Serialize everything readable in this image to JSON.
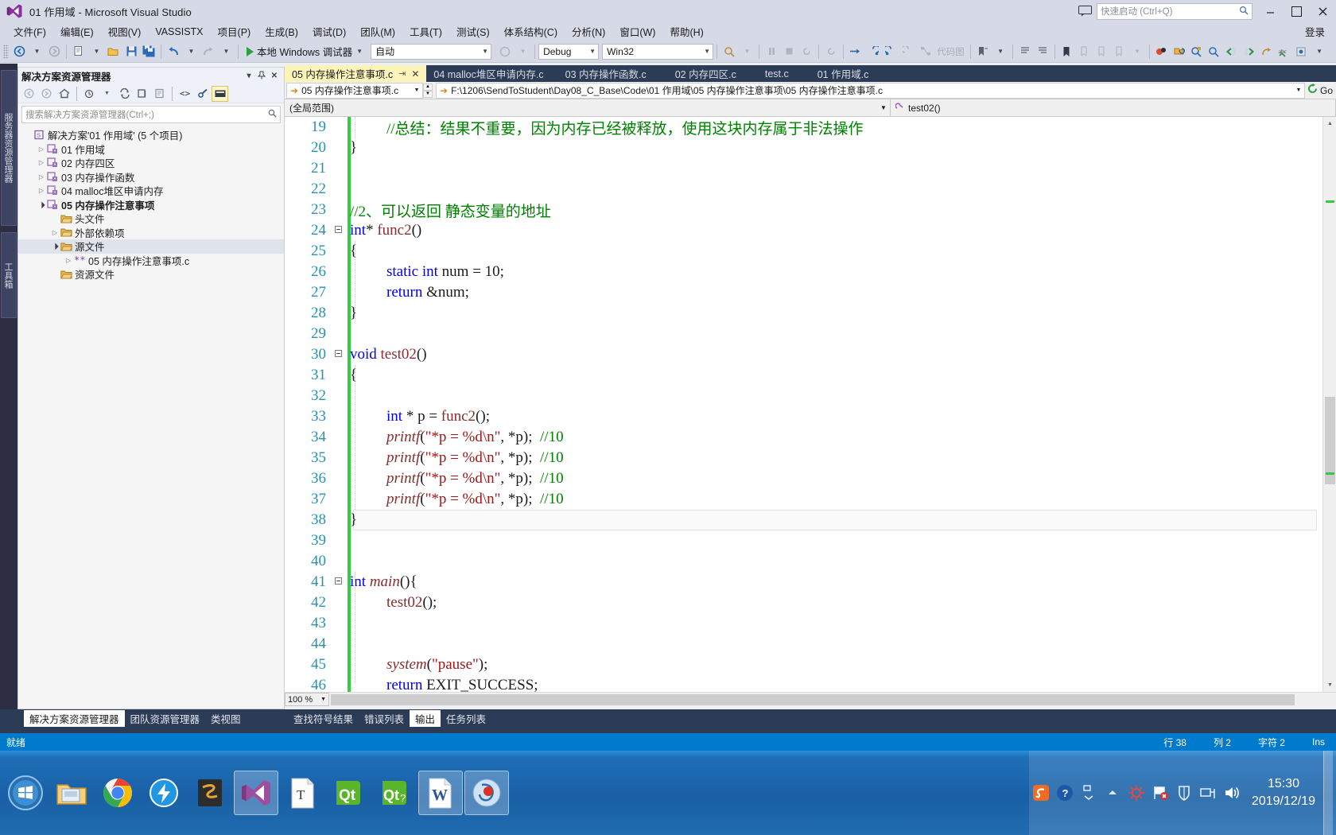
{
  "titlebar": {
    "title": "01 作用域 - Microsoft Visual Studio",
    "quick_launch_placeholder": "快速启动 (Ctrl+Q)",
    "minimize": "—",
    "maximize": "❐",
    "close": "✕",
    "feedback_icon": "feedback-icon",
    "search_icon": "search-icon"
  },
  "menubar": {
    "items": [
      {
        "label": "文件(F)"
      },
      {
        "label": "编辑(E)"
      },
      {
        "label": "视图(V)"
      },
      {
        "label": "VASSISTX"
      },
      {
        "label": "项目(P)"
      },
      {
        "label": "生成(B)"
      },
      {
        "label": "调试(D)"
      },
      {
        "label": "团队(M)"
      },
      {
        "label": "工具(T)"
      },
      {
        "label": "测试(S)"
      },
      {
        "label": "体系结构(C)"
      },
      {
        "label": "分析(N)"
      },
      {
        "label": "窗口(W)"
      },
      {
        "label": "帮助(H)"
      }
    ],
    "signin": "登录"
  },
  "toolbar": {
    "run_label": "本地 Windows 调试器",
    "config": "自动",
    "solution_config": "Debug",
    "platform": "Win32",
    "codemap_label": "代码图"
  },
  "vertical_tabs": [
    {
      "label": "服务器资源管理器"
    },
    {
      "label": "工具箱"
    }
  ],
  "solution_explorer": {
    "title": "解决方案资源管理器",
    "search_placeholder": "搜索解决方案资源管理器(Ctrl+;)",
    "root": "解决方案'01 作用域' (5 个项目)",
    "nodes": [
      {
        "label": "01 作用域",
        "indent": 1,
        "arrow": "collapsed",
        "icon": "project-icon",
        "bold": false
      },
      {
        "label": "02 内存四区",
        "indent": 1,
        "arrow": "collapsed",
        "icon": "project-icon",
        "bold": false
      },
      {
        "label": "03 内存操作函数",
        "indent": 1,
        "arrow": "collapsed",
        "icon": "project-icon",
        "bold": false
      },
      {
        "label": "04 malloc堆区申请内存",
        "indent": 1,
        "arrow": "collapsed",
        "icon": "project-icon",
        "bold": false
      },
      {
        "label": "05 内存操作注意事项",
        "indent": 1,
        "arrow": "expanded",
        "icon": "project-icon",
        "bold": true
      },
      {
        "label": "头文件",
        "indent": 2,
        "arrow": "none",
        "icon": "folder-icon",
        "bold": false
      },
      {
        "label": "外部依赖项",
        "indent": 2,
        "arrow": "collapsed",
        "icon": "folder-icon",
        "bold": false
      },
      {
        "label": "源文件",
        "indent": 2,
        "arrow": "expanded",
        "icon": "folder-icon",
        "bold": false,
        "selected": true
      },
      {
        "label": "05 内存操作注意事项.c",
        "indent": 3,
        "arrow": "collapsed",
        "icon": "c-file-icon",
        "bold": false
      },
      {
        "label": "资源文件",
        "indent": 2,
        "arrow": "none",
        "icon": "folder-icon",
        "bold": false
      }
    ]
  },
  "editor": {
    "tabs": [
      {
        "label": "05 内存操作注意事项.c",
        "active": true,
        "pin": "⇥",
        "close": "✕"
      },
      {
        "label": "04 malloc堆区申请内存.c",
        "active": false
      },
      {
        "label": "03 内存操作函数.c",
        "active": false
      },
      {
        "label": "02 内存四区.c",
        "active": false
      },
      {
        "label": "test.c",
        "active": false
      },
      {
        "label": "01 作用域.c",
        "active": false
      }
    ],
    "nav_file": "05 内存操作注意事项.c",
    "nav_path": "F:\\1206\\SendToStudent\\Day08_C_Base\\Code\\01 作用域\\05 内存操作注意事项\\05 内存操作注意事项.c",
    "go_label": "Go",
    "scope_left": "(全局范围)",
    "scope_right": "test02()",
    "zoom": "100 %",
    "lines": [
      {
        "n": 19,
        "fold": "",
        "indent": 2,
        "tokens": [
          {
            "t": "//总结：结果不重要，因为内存已经被释放，使用这块内存属于非法操作",
            "c": "c-com"
          }
        ]
      },
      {
        "n": 20,
        "fold": "",
        "indent": 0,
        "tokens": [
          {
            "t": "}",
            "c": "c-pln"
          }
        ]
      },
      {
        "n": 21,
        "fold": "",
        "indent": 0,
        "tokens": []
      },
      {
        "n": 22,
        "fold": "",
        "indent": 0,
        "tokens": []
      },
      {
        "n": 23,
        "fold": "",
        "indent": 0,
        "tokens": [
          {
            "t": "//2、可以返回 静态变量的地址",
            "c": "c-com"
          }
        ]
      },
      {
        "n": 24,
        "fold": "minus",
        "indent": 0,
        "tokens": [
          {
            "t": "int",
            "c": "c-kw"
          },
          {
            "t": "* ",
            "c": "c-pln"
          },
          {
            "t": "func2",
            "c": "c-fn2"
          },
          {
            "t": "()",
            "c": "c-pln"
          }
        ]
      },
      {
        "n": 25,
        "fold": "",
        "indent": 0,
        "tokens": [
          {
            "t": "{",
            "c": "c-pln"
          }
        ]
      },
      {
        "n": 26,
        "fold": "",
        "indent": 2,
        "tokens": [
          {
            "t": "static",
            "c": "c-kw"
          },
          {
            "t": " ",
            "c": "c-pln"
          },
          {
            "t": "int",
            "c": "c-kw"
          },
          {
            "t": " num = 10;",
            "c": "c-pln"
          }
        ]
      },
      {
        "n": 27,
        "fold": "",
        "indent": 2,
        "tokens": [
          {
            "t": "return",
            "c": "c-kw"
          },
          {
            "t": " &num;",
            "c": "c-pln"
          }
        ]
      },
      {
        "n": 28,
        "fold": "",
        "indent": 0,
        "tokens": [
          {
            "t": "}",
            "c": "c-pln"
          }
        ]
      },
      {
        "n": 29,
        "fold": "",
        "indent": 0,
        "tokens": []
      },
      {
        "n": 30,
        "fold": "minus",
        "indent": 0,
        "tokens": [
          {
            "t": "void",
            "c": "c-kw"
          },
          {
            "t": " ",
            "c": "c-pln"
          },
          {
            "t": "test02",
            "c": "c-fn2"
          },
          {
            "t": "()",
            "c": "c-pln"
          }
        ]
      },
      {
        "n": 31,
        "fold": "",
        "indent": 0,
        "tokens": [
          {
            "t": "{",
            "c": "c-pln"
          }
        ]
      },
      {
        "n": 32,
        "fold": "",
        "indent": 0,
        "tokens": []
      },
      {
        "n": 33,
        "fold": "",
        "indent": 2,
        "tokens": [
          {
            "t": "int",
            "c": "c-kw"
          },
          {
            "t": " * p = ",
            "c": "c-pln"
          },
          {
            "t": "func2",
            "c": "c-fn2"
          },
          {
            "t": "();",
            "c": "c-pln"
          }
        ]
      },
      {
        "n": 34,
        "fold": "",
        "indent": 2,
        "tokens": [
          {
            "t": "printf",
            "c": "c-fn"
          },
          {
            "t": "(",
            "c": "c-pln"
          },
          {
            "t": "\"*p = %d\\n\"",
            "c": "c-str"
          },
          {
            "t": ", *p);  ",
            "c": "c-pln"
          },
          {
            "t": "//10",
            "c": "c-com"
          }
        ]
      },
      {
        "n": 35,
        "fold": "",
        "indent": 2,
        "tokens": [
          {
            "t": "printf",
            "c": "c-fn"
          },
          {
            "t": "(",
            "c": "c-pln"
          },
          {
            "t": "\"*p = %d\\n\"",
            "c": "c-str"
          },
          {
            "t": ", *p);  ",
            "c": "c-pln"
          },
          {
            "t": "//10",
            "c": "c-com"
          }
        ]
      },
      {
        "n": 36,
        "fold": "",
        "indent": 2,
        "tokens": [
          {
            "t": "printf",
            "c": "c-fn"
          },
          {
            "t": "(",
            "c": "c-pln"
          },
          {
            "t": "\"*p = %d\\n\"",
            "c": "c-str"
          },
          {
            "t": ", *p);  ",
            "c": "c-pln"
          },
          {
            "t": "//10",
            "c": "c-com"
          }
        ]
      },
      {
        "n": 37,
        "fold": "",
        "indent": 2,
        "tokens": [
          {
            "t": "printf",
            "c": "c-fn"
          },
          {
            "t": "(",
            "c": "c-pln"
          },
          {
            "t": "\"*p = %d\\n\"",
            "c": "c-str"
          },
          {
            "t": ", *p);  ",
            "c": "c-pln"
          },
          {
            "t": "//10",
            "c": "c-com"
          }
        ]
      },
      {
        "n": 38,
        "fold": "",
        "indent": 0,
        "current": true,
        "tokens": [
          {
            "t": "}",
            "c": "c-pln"
          }
        ]
      },
      {
        "n": 39,
        "fold": "",
        "indent": 0,
        "tokens": []
      },
      {
        "n": 40,
        "fold": "",
        "indent": 0,
        "tokens": []
      },
      {
        "n": 41,
        "fold": "minus",
        "indent": 0,
        "tokens": [
          {
            "t": "int",
            "c": "c-kw"
          },
          {
            "t": " ",
            "c": "c-pln"
          },
          {
            "t": "main",
            "c": "c-fn"
          },
          {
            "t": "(){",
            "c": "c-pln"
          }
        ]
      },
      {
        "n": 42,
        "fold": "",
        "indent": 2,
        "tokens": [
          {
            "t": "test02",
            "c": "c-fn2"
          },
          {
            "t": "();",
            "c": "c-pln"
          }
        ]
      },
      {
        "n": 43,
        "fold": "",
        "indent": 0,
        "tokens": []
      },
      {
        "n": 44,
        "fold": "",
        "indent": 0,
        "tokens": []
      },
      {
        "n": 45,
        "fold": "",
        "indent": 2,
        "tokens": [
          {
            "t": "system",
            "c": "c-fn"
          },
          {
            "t": "(",
            "c": "c-pln"
          },
          {
            "t": "\"pause\"",
            "c": "c-str"
          },
          {
            "t": ");",
            "c": "c-pln"
          }
        ]
      },
      {
        "n": 46,
        "fold": "",
        "indent": 2,
        "tokens": [
          {
            "t": "return",
            "c": "c-kw"
          },
          {
            "t": " EXIT_SUCCESS;",
            "c": "c-pln"
          }
        ]
      }
    ]
  },
  "bottom_tabs": {
    "left": [
      {
        "label": "解决方案资源管理器",
        "active": true
      },
      {
        "label": "团队资源管理器",
        "active": false
      },
      {
        "label": "类视图",
        "active": false
      }
    ],
    "right": [
      {
        "label": "查找符号结果",
        "active": false
      },
      {
        "label": "错误列表",
        "active": false
      },
      {
        "label": "输出",
        "active": true
      },
      {
        "label": "任务列表",
        "active": false
      }
    ]
  },
  "statusbar": {
    "ready": "就绪",
    "line": "行 38",
    "col": "列 2",
    "char": "字符 2",
    "ins": "Ins"
  },
  "taskbar": {
    "items": [
      {
        "name": "start-orb",
        "label": ""
      },
      {
        "name": "file-explorer-icon",
        "label": ""
      },
      {
        "name": "chrome-icon",
        "label": ""
      },
      {
        "name": "thunder-icon",
        "label": ""
      },
      {
        "name": "sublime-icon",
        "label": ""
      },
      {
        "name": "visual-studio-icon",
        "label": "",
        "pressed": true
      },
      {
        "name": "typora-icon",
        "label": "T"
      },
      {
        "name": "qt-creator-icon",
        "label": "Qt"
      },
      {
        "name": "qt-assistant-icon",
        "label": "Qt"
      },
      {
        "name": "word-icon",
        "label": "W",
        "pressed": true
      },
      {
        "name": "recorder-icon",
        "label": "",
        "pressed": true
      }
    ],
    "tray": [
      {
        "name": "sogou-icon"
      },
      {
        "name": "help-icon"
      },
      {
        "name": "show-hidden-icon"
      },
      {
        "name": "antivirus-icon"
      },
      {
        "name": "flag-error-icon"
      },
      {
        "name": "shield-icon"
      },
      {
        "name": "network-icon"
      },
      {
        "name": "volume-icon"
      }
    ],
    "time": "15:30",
    "date": "2019/12/19"
  },
  "colors": {
    "accent": "#007acc",
    "titlebar": "#d6d9e6",
    "tabstrip": "#2d3c56",
    "active_tab": "#fdf4ba",
    "changebar": "#2fce3c",
    "comment": "#008000",
    "keyword": "#0000ff",
    "string": "#a31515",
    "function": "#8b2c2c",
    "linenumber": "#2b91af"
  }
}
